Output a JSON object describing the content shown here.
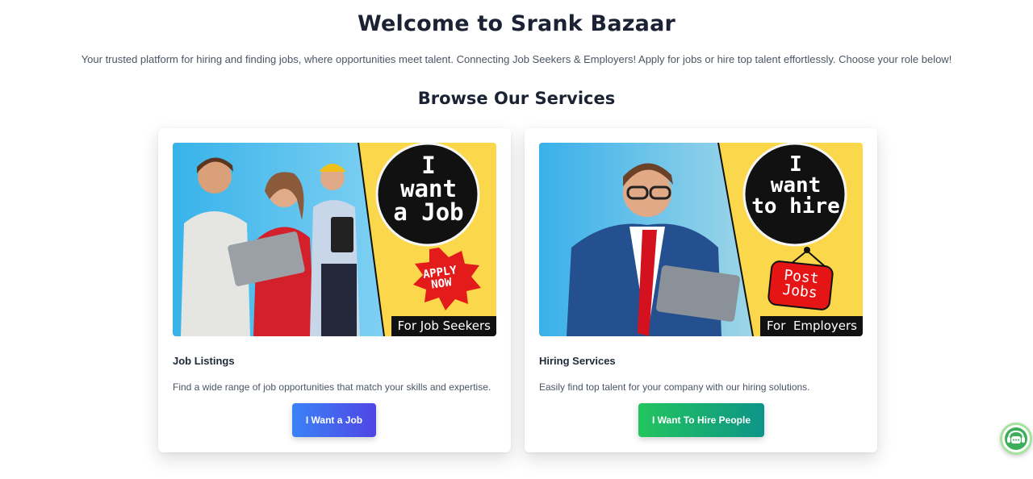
{
  "header": {
    "title": "Welcome to Srank Bazaar",
    "subtitle": "Your trusted platform for hiring and finding jobs, where opportunities meet talent. Connecting Job Seekers & Employers! Apply for jobs or hire top talent effortlessly. Choose your role below!"
  },
  "services": {
    "heading": "Browse Our Services",
    "cards": [
      {
        "banner": {
          "circle_line1": "I",
          "circle_line2": "want",
          "circle_line3": "a Job",
          "badge_line1": "APPLY",
          "badge_line2": "NOW",
          "tag": "For Job Seekers"
        },
        "title": "Job Listings",
        "description": "Find a wide range of job opportunities that match your skills and expertise.",
        "button_label": "I Want a Job"
      },
      {
        "banner": {
          "circle_line1": "I",
          "circle_line2": "want",
          "circle_line3": "to hire",
          "sign_line1": "Post",
          "sign_line2": "Jobs",
          "tag": "For  Employers"
        },
        "title": "Hiring Services",
        "description": "Easily find top talent for your company with our hiring solutions.",
        "button_label": "I Want To Hire People"
      }
    ]
  },
  "chat_widget": {
    "icon": "chat-support-icon"
  },
  "colors": {
    "banner_yellow": "#fbd84b",
    "banner_blue": "#3fb4e8",
    "job_button_start": "#3b82f6",
    "job_button_end": "#4f46e5",
    "hire_button_start": "#22c55e",
    "hire_button_end": "#0d9488",
    "heading": "#1a2233"
  }
}
